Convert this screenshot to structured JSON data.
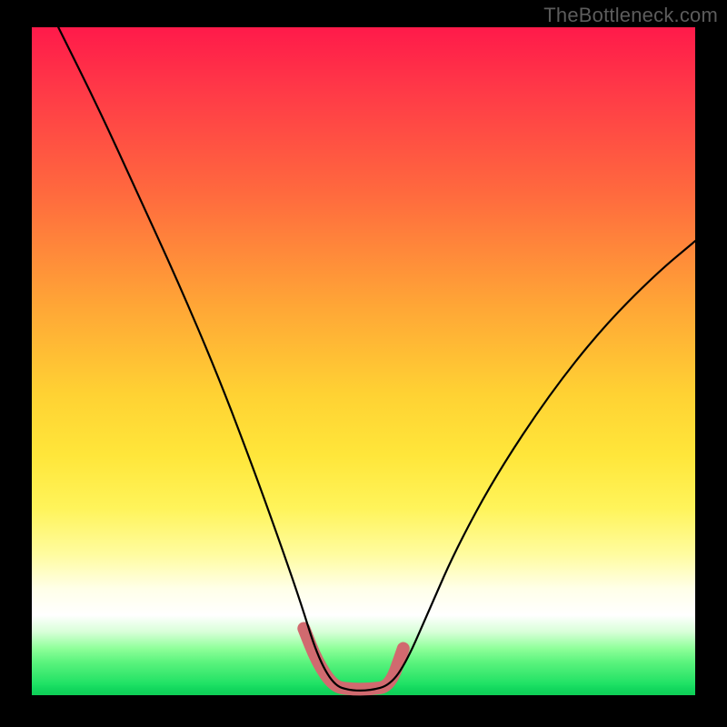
{
  "branding": "TheBottleneck.com",
  "chart_data": {
    "type": "line",
    "title": "",
    "xlabel": "",
    "ylabel": "",
    "xlim": [
      0,
      100
    ],
    "ylim": [
      0,
      100
    ],
    "series": [
      {
        "name": "bottleneck-curve",
        "color": "#000000",
        "x": [
          4,
          10,
          16,
          22,
          28,
          33,
          37,
          40.5,
          43,
          45.5,
          48,
          51,
          54,
          56.5,
          60,
          64,
          70,
          78,
          86,
          94,
          100
        ],
        "y": [
          100,
          88,
          75,
          62,
          48,
          35,
          24,
          14,
          6,
          1.5,
          0.7,
          0.7,
          1.5,
          5,
          13,
          22,
          33,
          45,
          55,
          63,
          68
        ]
      },
      {
        "name": "highlight-band",
        "color": "#d16a6f",
        "x": [
          41,
          43,
          45.5,
          48,
          51,
          54,
          56
        ],
        "y": [
          10,
          5,
          1.3,
          0.9,
          0.9,
          1.3,
          7
        ]
      }
    ]
  }
}
